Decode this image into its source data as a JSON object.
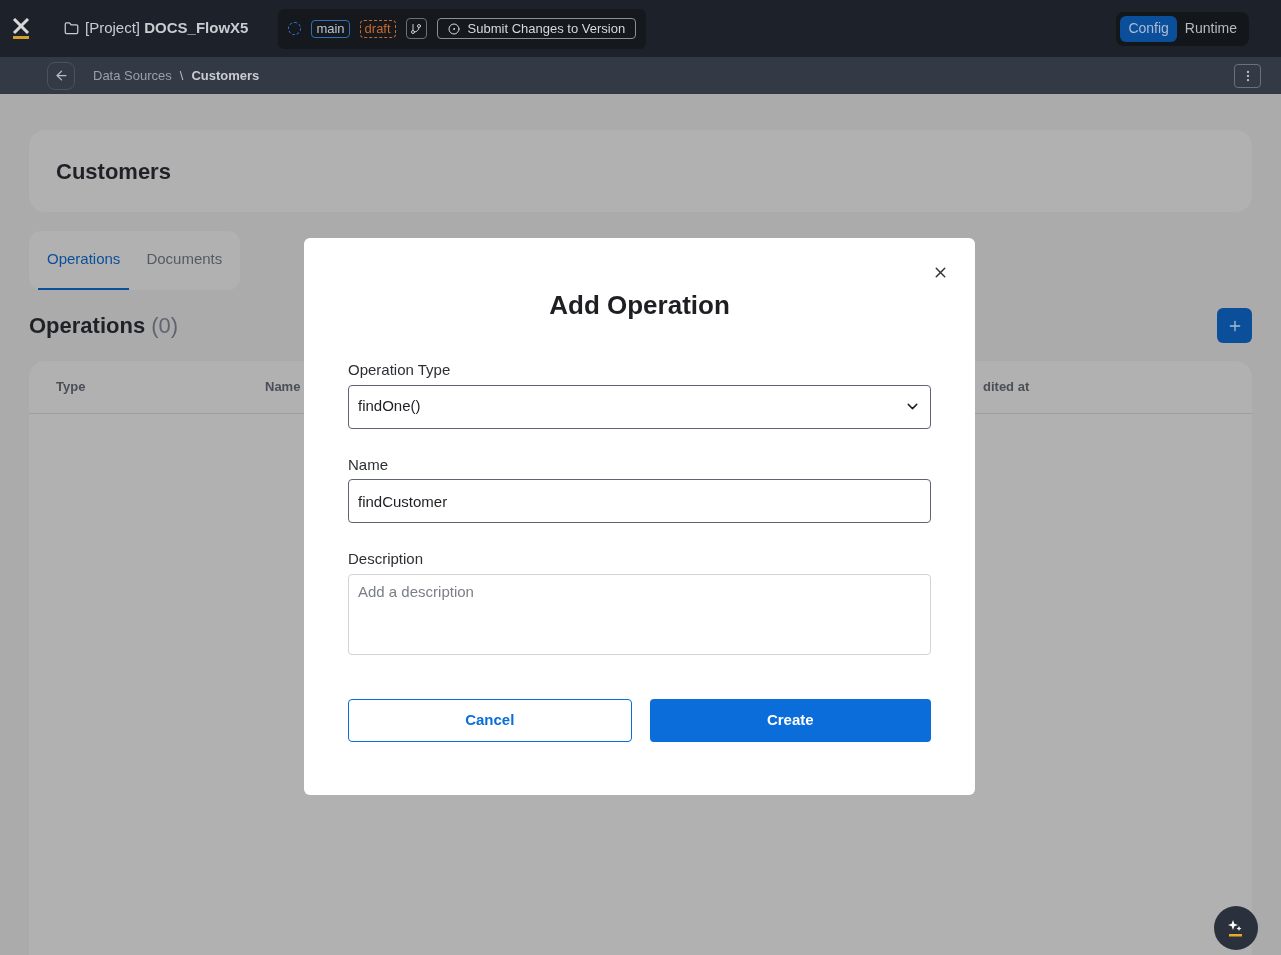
{
  "header": {
    "project_prefix": "[Project]",
    "project_name": "DOCS_FlowX5",
    "branch": "main",
    "status": "draft",
    "submit_button": "Submit Changes to Version",
    "modes": [
      {
        "label": "Config",
        "selected": true
      },
      {
        "label": "Runtime",
        "selected": false
      }
    ]
  },
  "breadcrumb": [
    {
      "label": "Data Sources",
      "current": false
    },
    {
      "label": "Customers",
      "current": true
    }
  ],
  "breadcrumb_separator": "\\",
  "page_title": "Customers",
  "tabs": [
    {
      "label": "Operations",
      "selected": true
    },
    {
      "label": "Documents",
      "selected": false
    }
  ],
  "section": {
    "title": "Operations",
    "count": "(0)"
  },
  "table": {
    "columns": [
      "Type",
      "Name",
      "dited at"
    ]
  },
  "dialog": {
    "title": "Add Operation",
    "fields": [
      {
        "kind": "select",
        "label": "Operation Type",
        "value": "findOne()"
      },
      {
        "kind": "text",
        "label": "Name",
        "value": "findCustomer"
      },
      {
        "kind": "textarea",
        "label": "Description",
        "placeholder": "Add a description"
      }
    ],
    "buttons": [
      {
        "label": "Cancel",
        "kind": "secondary"
      },
      {
        "label": "Create",
        "kind": "primary"
      }
    ]
  }
}
